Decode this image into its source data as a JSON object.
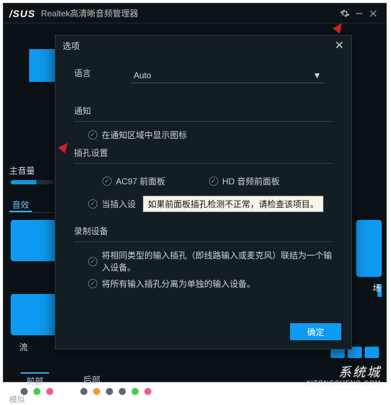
{
  "titlebar": {
    "logo": "/SUS",
    "title": "Realtek高清晰音频管理器"
  },
  "main": {
    "volume_label": "主音量",
    "tab_effects": "音效",
    "tile_stream_label": "流",
    "port_front": "前部",
    "port_rear": "后部",
    "side_label": "场",
    "sim_label": "模拟"
  },
  "dialog": {
    "title": "选项",
    "lang_label": "语言",
    "lang_value": "Auto",
    "notify_label": "通知",
    "notify_opt": "在通知区域中显示图标",
    "jack_label": "插孔设置",
    "jack_ac97": "AC97 前面板",
    "jack_hd": "HD 音频前面板",
    "jack_onplug_prefix": "当插入设",
    "tooltip": "如果前面板插孔检测不正常，请检查该项目。",
    "rec_label": "录制设备",
    "rec_opt1": "将相同类型的输入插孔（即线路输入或麦克风）联结为一个输入设备。",
    "rec_opt2": "将所有输入插孔分离为单独的输入设备。",
    "ok": "确定"
  },
  "watermark": {
    "text": "系统城",
    "url": "XITONGCHENG.COM"
  }
}
